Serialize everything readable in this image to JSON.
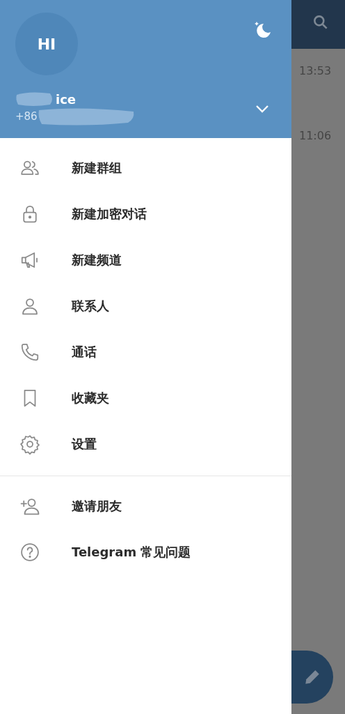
{
  "drawer": {
    "avatar_initials": "HI",
    "name": "ice",
    "phone": "+86",
    "menu": [
      {
        "kind": "group",
        "label": "新建群组"
      },
      {
        "kind": "lock",
        "label": "新建加密对话"
      },
      {
        "kind": "megaphone",
        "label": "新建频道"
      },
      {
        "kind": "person",
        "label": "联系人"
      },
      {
        "kind": "phone",
        "label": "通话"
      },
      {
        "kind": "bookmark",
        "label": "收藏夹"
      },
      {
        "kind": "gear",
        "label": "设置"
      }
    ],
    "extra_menu": [
      {
        "kind": "invite",
        "label": "邀请朋友"
      },
      {
        "kind": "help",
        "label": "Telegram 常见问题"
      }
    ]
  },
  "chat_list": {
    "times": [
      "13:53",
      "11:06"
    ]
  }
}
